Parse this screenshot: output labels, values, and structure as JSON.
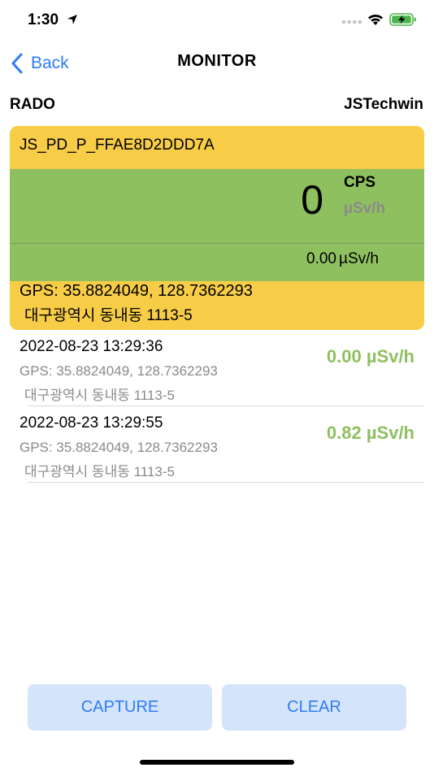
{
  "status_bar": {
    "time": "1:30",
    "icons": [
      "location-arrow-icon",
      "signal-dots-icon",
      "wifi-icon",
      "battery-charging-icon"
    ]
  },
  "nav": {
    "back_label": "Back",
    "title": "MONITOR"
  },
  "brand": {
    "left": "RADO",
    "right": "JSTechwin"
  },
  "monitor": {
    "device_id": "JS_PD_P_FFAE8D2DDD7A",
    "count": "0",
    "count_unit": "CPS",
    "rate_unit": "µSv/h",
    "dose_value": "0.00",
    "dose_unit": "µSv/h",
    "gps": "GPS: 35.8824049, 128.7362293",
    "address": "대구광역시 동내동  1113-5"
  },
  "history": [
    {
      "timestamp": "2022-08-23 13:29:36",
      "gps": "GPS: 35.8824049, 128.7362293",
      "address": "대구광역시 동내동  1113-5",
      "dose": "0.00 µSv/h"
    },
    {
      "timestamp": "2022-08-23 13:29:55",
      "gps": "GPS: 35.8824049, 128.7362293",
      "address": "대구광역시 동내동  1113-5",
      "dose": "0.82 µSv/h"
    }
  ],
  "actions": {
    "capture_label": "CAPTURE",
    "clear_label": "CLEAR"
  },
  "colors": {
    "accent_blue": "#2f7cf6",
    "card_yellow": "#f7cc47",
    "reading_green": "#8fc060",
    "button_bg": "#d4e4fb"
  }
}
